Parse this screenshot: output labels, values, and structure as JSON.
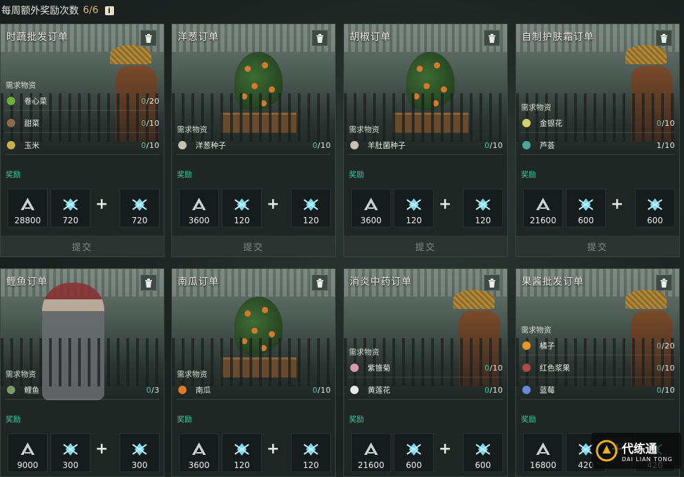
{
  "header": {
    "label": "每周额外奖励次数",
    "count": "6/6",
    "info_icon": "info-icon"
  },
  "labels": {
    "required": "需求物资",
    "reward": "奖励",
    "submit": "提交",
    "plus": "+"
  },
  "colors": {
    "progress_incomplete": "#46c8a8",
    "reward_label": "#3fc9a5",
    "count_gold": "#d9b56a"
  },
  "orders": [
    {
      "title": "时蔬批发订单",
      "scene": "farmer",
      "items": [
        {
          "name": "卷心菜",
          "cur": "0",
          "tot": "/20",
          "icon": "cabbage-icon"
        },
        {
          "name": "甜菜",
          "cur": "0",
          "tot": "/10",
          "icon": "beet-icon"
        },
        {
          "name": "玉米",
          "cur": "0",
          "tot": "/10",
          "icon": "corn-icon"
        }
      ],
      "rewards": [
        "28800",
        "720",
        "720"
      ]
    },
    {
      "title": "洋葱订单",
      "scene": "plant",
      "items": [
        {
          "name": "洋葱种子",
          "cur": "0",
          "tot": "/10",
          "icon": "seed-bag-icon"
        }
      ],
      "rewards": [
        "3600",
        "120",
        "120"
      ]
    },
    {
      "title": "胡椒订单",
      "scene": "plant",
      "items": [
        {
          "name": "羊肚菌种子",
          "cur": "0",
          "tot": "/10",
          "icon": "seed-bag-icon"
        }
      ],
      "rewards": [
        "3600",
        "120",
        "120"
      ]
    },
    {
      "title": "自制护肤霜订单",
      "scene": "farmer",
      "items": [
        {
          "name": "金银花",
          "cur": "0",
          "tot": "/10",
          "icon": "honeysuckle-icon"
        },
        {
          "name": "芦荟",
          "cur": "1",
          "tot": "/10",
          "icon": "aloe-icon"
        }
      ],
      "rewards": [
        "21600",
        "600",
        "600"
      ]
    },
    {
      "title": "鲤鱼订单",
      "scene": "soldier",
      "items": [
        {
          "name": "鲤鱼",
          "cur": "0",
          "tot": "/3",
          "icon": "fish-icon"
        }
      ],
      "rewards": [
        "9000",
        "300",
        "300"
      ]
    },
    {
      "title": "南瓜订单",
      "scene": "plant",
      "items": [
        {
          "name": "南瓜",
          "cur": "0",
          "tot": "/10",
          "icon": "pumpkin-icon"
        }
      ],
      "rewards": [
        "3600",
        "120",
        "120"
      ]
    },
    {
      "title": "消炎中药订单",
      "scene": "farmer",
      "items": [
        {
          "name": "紫锥菊",
          "cur": "0",
          "tot": "/10",
          "icon": "echinacea-icon"
        },
        {
          "name": "黄莲花",
          "cur": "0",
          "tot": "/10",
          "icon": "lotus-icon"
        }
      ],
      "rewards": [
        "21600",
        "600",
        "600"
      ]
    },
    {
      "title": "果酱批发订单",
      "scene": "farmer",
      "items": [
        {
          "name": "橘子",
          "cur": "0",
          "tot": "/20",
          "icon": "orange-icon"
        },
        {
          "name": "红色浆果",
          "cur": "0",
          "tot": "/10",
          "icon": "red-berry-icon"
        },
        {
          "name": "蓝莓",
          "cur": "0",
          "tot": "/10",
          "icon": "blueberry-icon"
        }
      ],
      "rewards": [
        "16800",
        "420",
        "420"
      ]
    }
  ],
  "watermark": {
    "cn": "代练通",
    "en": "DAI LIAN TONG"
  }
}
